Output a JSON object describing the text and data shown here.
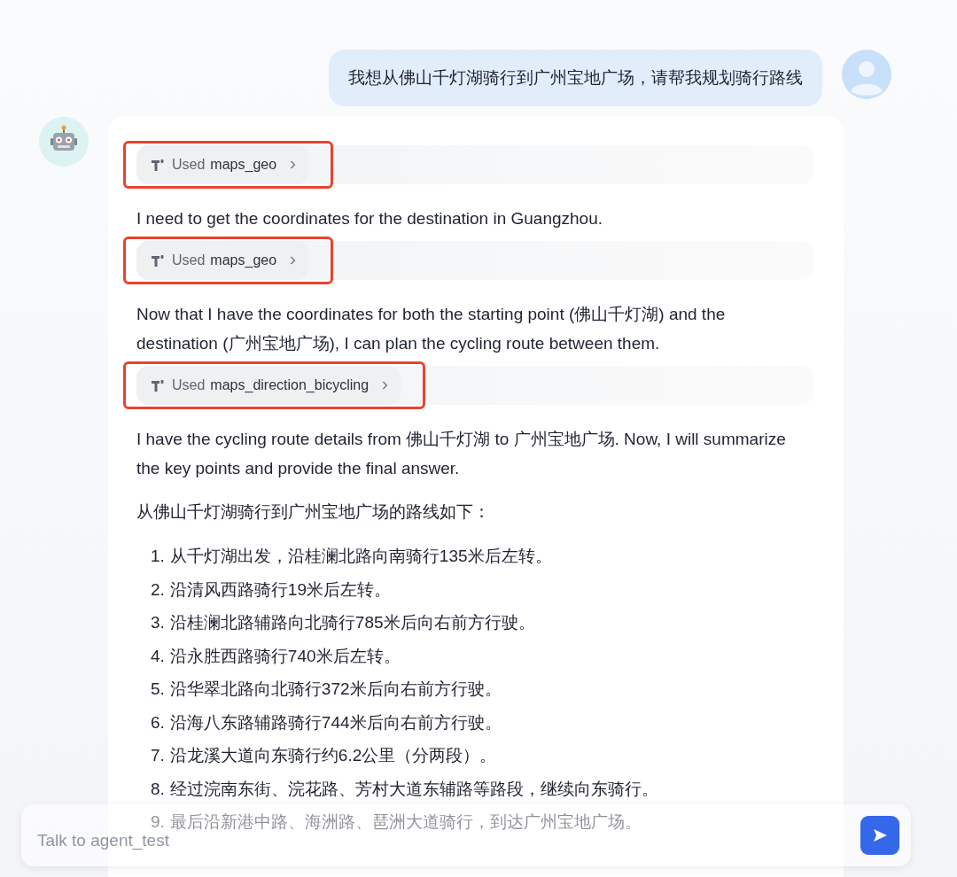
{
  "user_message": {
    "text": "我想从佛山千灯湖骑行到广州宝地广场，请帮我规划骑行路线"
  },
  "assistant": {
    "blocks": [
      {
        "kind": "tool",
        "label": "Used",
        "tool": "maps_geo",
        "highlighted": true
      },
      {
        "kind": "text",
        "text": "I need to get the coordinates for the destination in Guangzhou."
      },
      {
        "kind": "tool",
        "label": "Used",
        "tool": "maps_geo",
        "highlighted": true
      },
      {
        "kind": "text",
        "text": "Now that I have the coordinates for both the starting point (佛山千灯湖) and the destination (广州宝地广场), I can plan the cycling route between them."
      },
      {
        "kind": "tool",
        "label": "Used",
        "tool": "maps_direction_bicycling",
        "highlighted": true
      },
      {
        "kind": "text",
        "text": "I have the cycling route details from 佛山千灯湖 to 广州宝地广场. Now, I will summarize the key points and provide the final answer."
      },
      {
        "kind": "text",
        "text": "从佛山千灯湖骑行到广州宝地广场的路线如下："
      },
      {
        "kind": "list",
        "items": [
          {
            "number": "1.",
            "text": "从千灯湖出发，沿桂澜北路向南骑行135米后左转。"
          },
          {
            "number": "2.",
            "text": "沿清风西路骑行19米后左转。"
          },
          {
            "number": "3.",
            "text": "沿桂澜北路辅路向北骑行785米后向右前方行驶。"
          },
          {
            "number": "4.",
            "text": "沿永胜西路骑行740米后左转。"
          },
          {
            "number": "5.",
            "text": "沿华翠北路向北骑行372米后向右前方行驶。"
          },
          {
            "number": "6.",
            "text": "沿海八东路辅路骑行744米后向右前方行驶。"
          },
          {
            "number": "7.",
            "text": "沿龙溪大道向东骑行约6.2公里（分两段）。"
          },
          {
            "number": "8.",
            "text": "经过浣南东街、浣花路、芳村大道东辅路等路段，继续向东骑行。"
          },
          {
            "number": "9.",
            "text": "最后沿新港中路、海洲路、琶洲大道骑行，到达广州宝地广场。"
          }
        ]
      }
    ]
  },
  "input": {
    "placeholder": "Talk to agent_test"
  }
}
